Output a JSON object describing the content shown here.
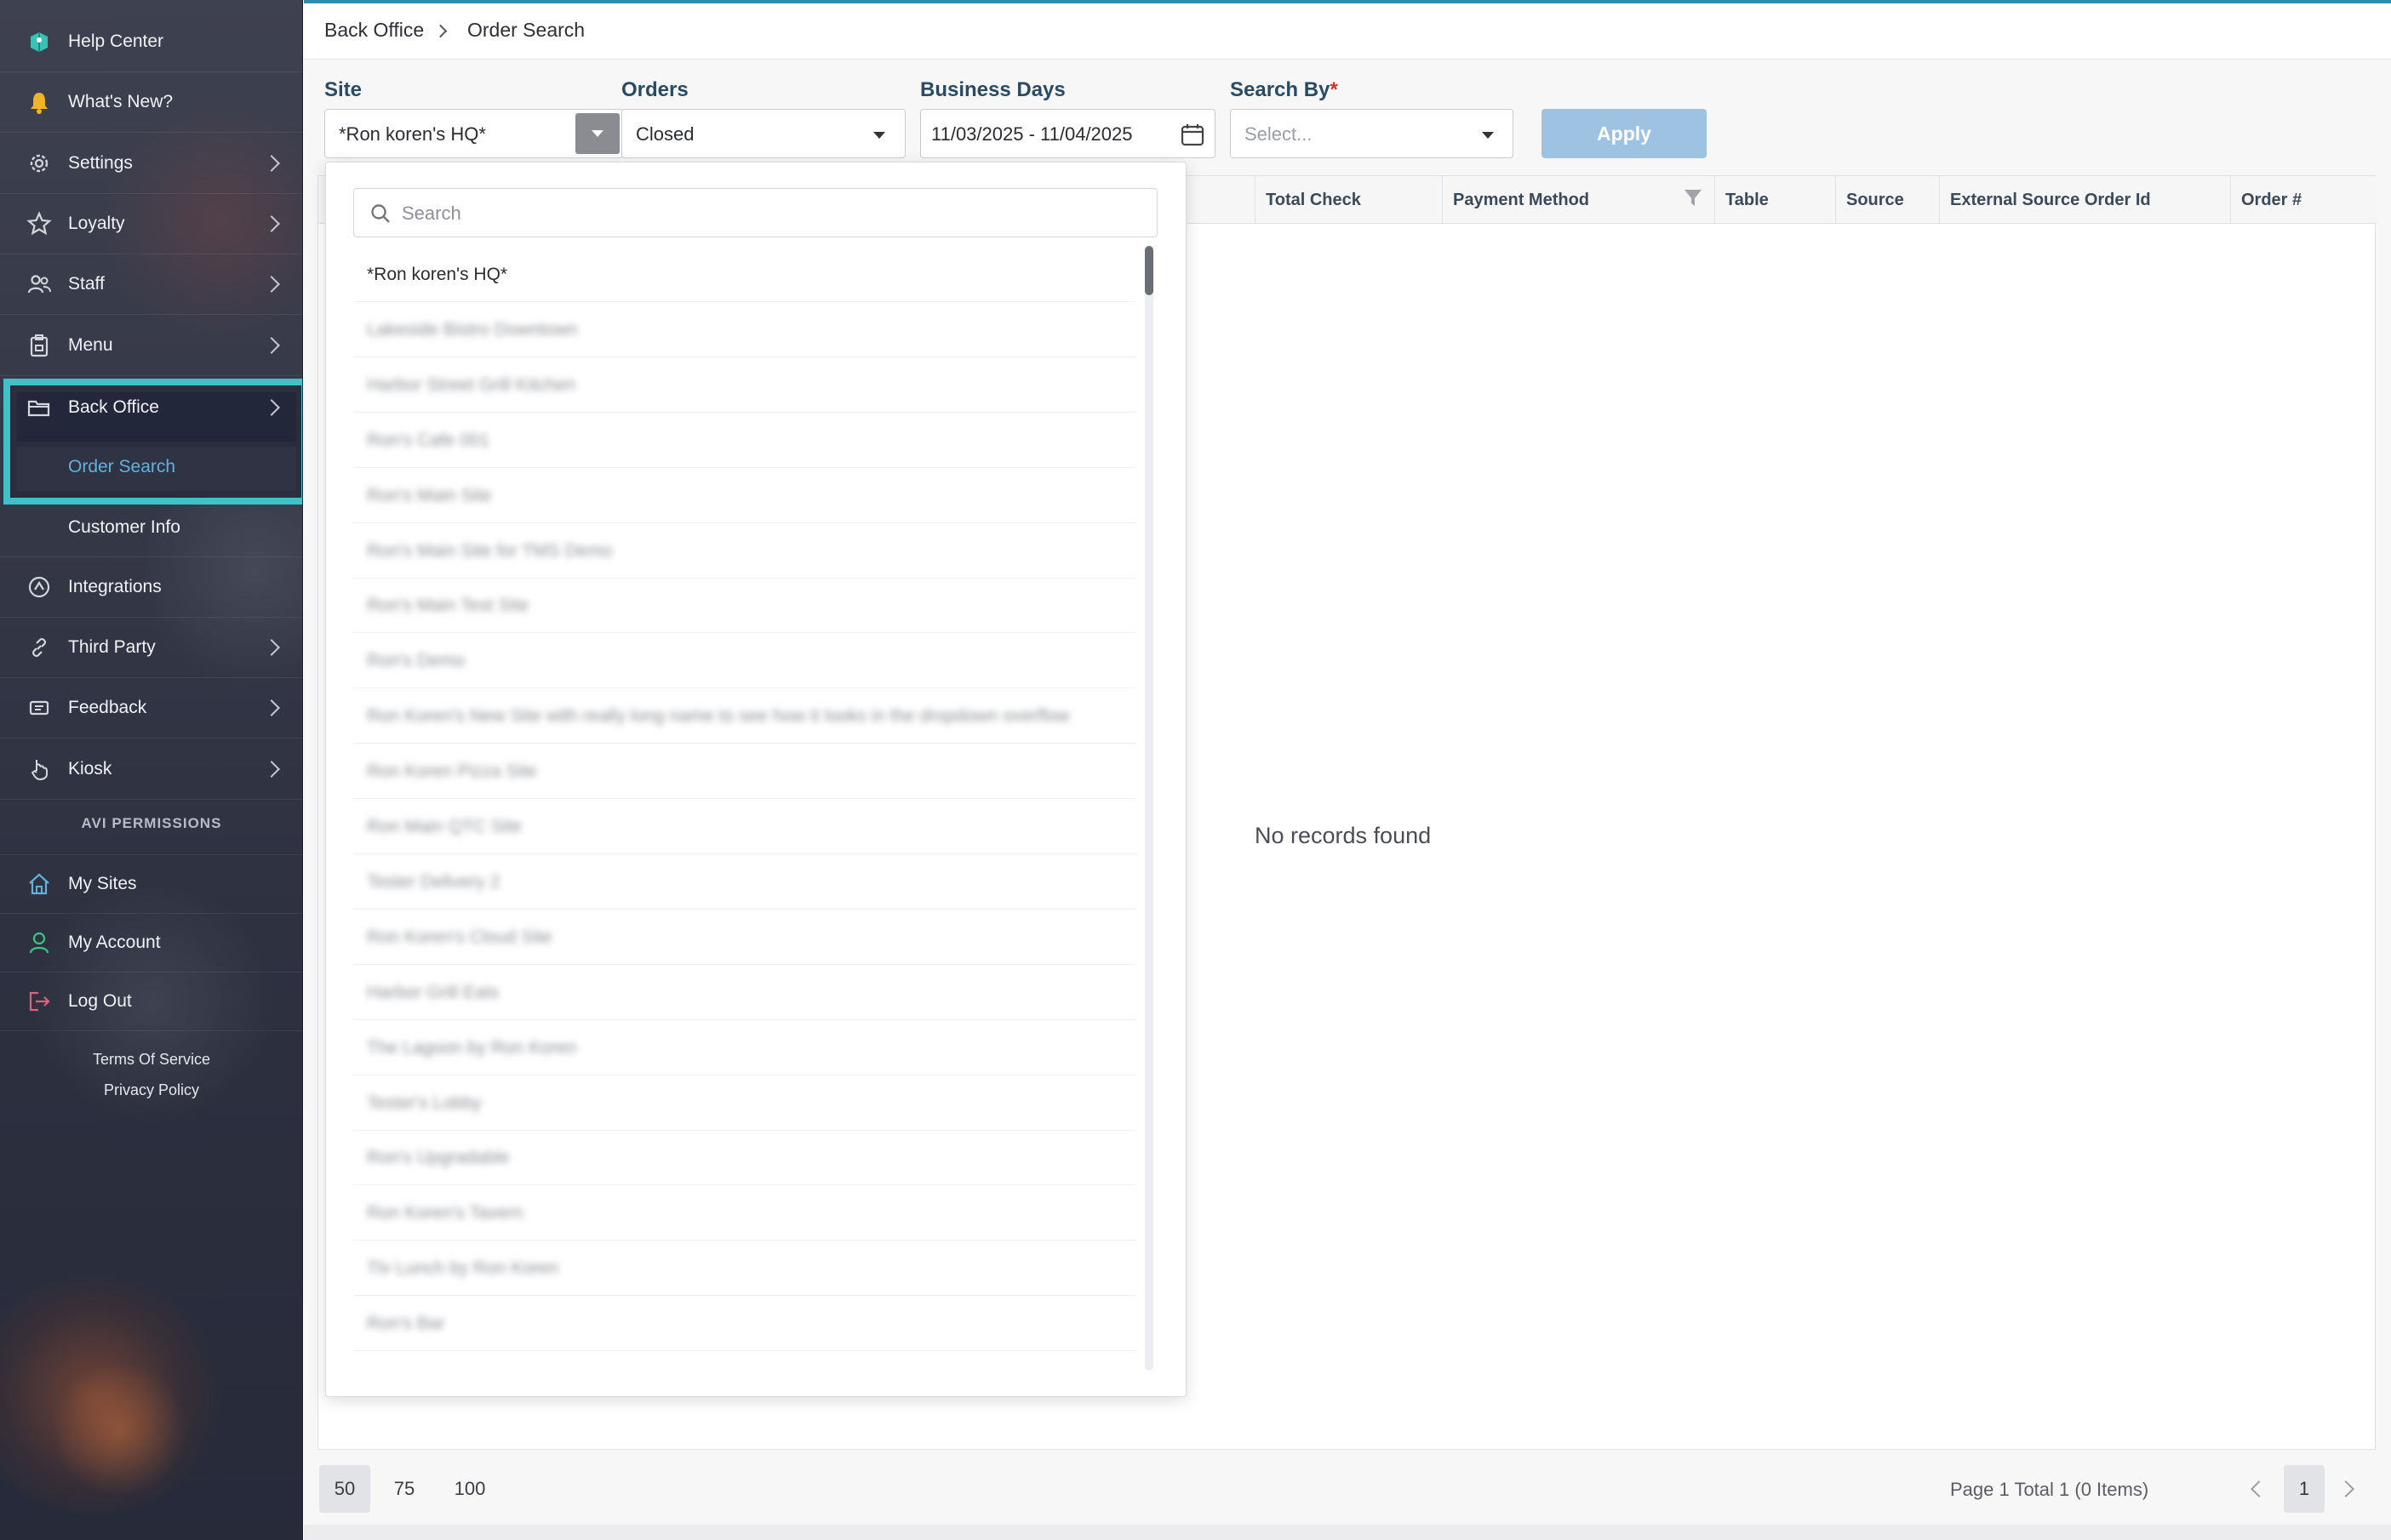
{
  "sidebar": {
    "items": [
      {
        "label": "Help Center",
        "icon": "help-center-icon"
      },
      {
        "label": "What's New?",
        "icon": "bell-icon"
      },
      {
        "label": "Settings",
        "icon": "gear-icon"
      },
      {
        "label": "Loyalty",
        "icon": "star-icon"
      },
      {
        "label": "Staff",
        "icon": "users-icon"
      },
      {
        "label": "Menu",
        "icon": "menu-clipboard-icon"
      },
      {
        "label": "Back Office",
        "icon": "folder-icon"
      },
      {
        "label": "Integrations",
        "icon": "integrations-icon"
      },
      {
        "label": "Third Party",
        "icon": "link-icon"
      },
      {
        "label": "Feedback",
        "icon": "feedback-icon"
      },
      {
        "label": "Kiosk",
        "icon": "hand-pointer-icon"
      }
    ],
    "back_office_sub": {
      "order_search": "Order Search",
      "customer_info": "Customer Info"
    },
    "permissions_label": "AVI PERMISSIONS",
    "account_items": [
      {
        "label": "My Sites",
        "icon": "home-icon"
      },
      {
        "label": "My Account",
        "icon": "user-icon"
      },
      {
        "label": "Log Out",
        "icon": "logout-icon"
      }
    ],
    "footer": {
      "terms": "Terms Of Service",
      "privacy": "Privacy Policy"
    },
    "colors": {
      "highlight": "#41c0c8",
      "active_sub_text": "#5fb2dc"
    }
  },
  "breadcrumb": {
    "root": "Back Office",
    "current": "Order Search"
  },
  "filters": {
    "site": {
      "label": "Site",
      "value": "*Ron koren's HQ*"
    },
    "orders": {
      "label": "Orders",
      "value": "Closed"
    },
    "business_days": {
      "label": "Business Days",
      "value": "11/03/2025 - 11/04/2025"
    },
    "search_by": {
      "label": "Search By",
      "required": "*",
      "placeholder": "Select..."
    },
    "apply_label": "Apply"
  },
  "table": {
    "columns": [
      "Total Check",
      "Payment Method",
      "Table",
      "Source",
      "External Source Order Id",
      "Order #"
    ],
    "empty_text": "No records found"
  },
  "pager": {
    "sizes": [
      "50",
      "75",
      "100"
    ],
    "active_size": "50",
    "info": "Page 1 Total 1 (0 Items)",
    "current_page": "1"
  },
  "site_dropdown": {
    "search_placeholder": "Search",
    "options": [
      "*Ron koren's HQ*",
      "Lakeside Bistro Downtown",
      "Harbor Street Grill Kitchen",
      "Ron's Cafe 001",
      "Ron's Main Site",
      "Ron's Main Site for TMS Demo",
      "Ron's Main Test Site",
      "Ron's Demo",
      "Ron Koren's New Site with really long name to see how it looks in the dropdown overflow",
      "Ron Koren Pizza Site",
      "Ron Main QTC Site",
      "Tester Delivery 2",
      "Ron Koren's Cloud Site",
      "Harbor Grill Eats",
      "The Lagoon by Ron Koren",
      "Tester's Lobby",
      "Ron's Upgradable",
      "Ron Koren's Tavern",
      "Tlv Lunch by Ron Koren",
      "Ron's Bar"
    ]
  }
}
